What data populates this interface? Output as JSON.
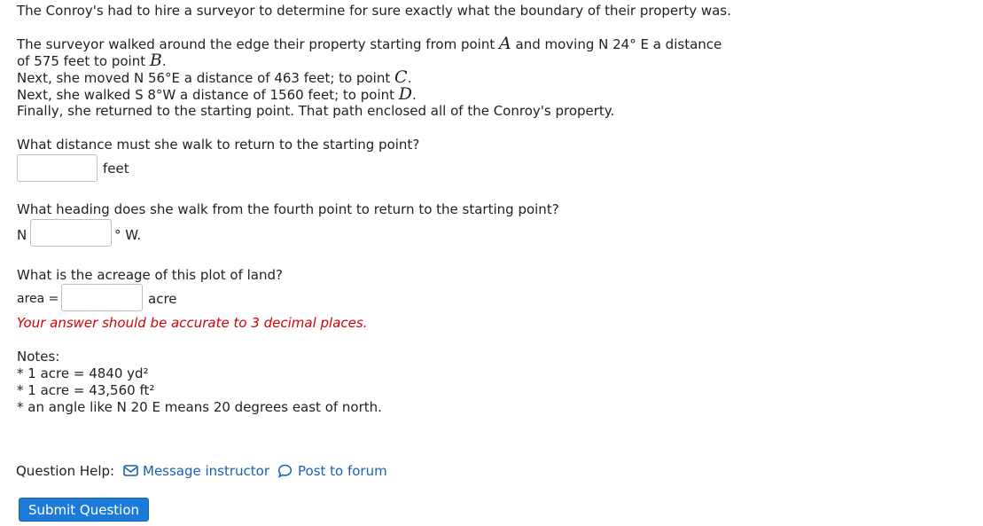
{
  "question": {
    "intro": "The Conroy's had to hire a surveyor to determine for sure exactly what the boundary of their property was.",
    "para": {
      "line1_pre": "The surveyor walked around the edge their property starting from point ",
      "point_a": "A",
      "line1_post": " and moving N  24° E a distance",
      "line2_pre": "of 575 feet to point ",
      "point_b": "B",
      "line2_post": ".",
      "line3_pre": "Next, she moved N 56°E a distance of 463 feet; to point ",
      "point_c": "C",
      "line3_post": ".",
      "line4_pre": "Next, she walked S 8°W a distance of 1560 feet; to point ",
      "point_d": "D",
      "line4_post": ".",
      "line5": "Finally, she returned to the starting point. That path enclosed all of the Conroy's property."
    },
    "part1": {
      "prompt": "What distance must she walk to return to the starting point?",
      "value": "",
      "unit": "feet"
    },
    "part2": {
      "prompt": "What heading does she walk from the fourth point to return to the starting point?",
      "prefix": "N",
      "value": "",
      "suffix": "° W."
    },
    "part3": {
      "prompt": "What is the acreage of this plot of land?",
      "prefix": "area =",
      "value": "",
      "unit": "acre",
      "warning": "Your answer should be accurate to 3 decimal places."
    },
    "notes": {
      "title": "Notes:",
      "items": [
        "* 1 acre = 4840 yd²",
        "* 1 acre = 43,560 ft²",
        "* an angle like N 20 E means 20 degrees east of north."
      ]
    }
  },
  "help": {
    "label": "Question Help:",
    "message_link": "Message instructor",
    "forum_link": "Post to forum",
    "icons": [
      "envelope-icon",
      "speech-bubble-icon"
    ]
  },
  "submit_label": "Submit Question",
  "colors": {
    "text": "#222222",
    "link": "#1a5fb4",
    "warning": "#d40000",
    "button": "#1c7ad8"
  }
}
